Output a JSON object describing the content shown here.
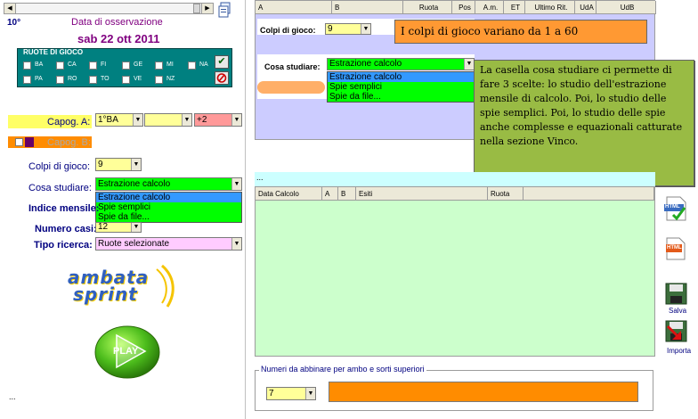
{
  "left": {
    "number": "10°",
    "obs_label": "Data di osservazione",
    "obs_date": "sab 22 ott 2011",
    "ruote": {
      "title": "RUOTE DI GIOCO",
      "row1": [
        "BA",
        "CA",
        "FI",
        "GE",
        "MI",
        "NA"
      ],
      "row2": [
        "PA",
        "RO",
        "TO",
        "VE",
        "NZ"
      ]
    },
    "capog_a": {
      "label": "Capog. A:",
      "val1": "1°BA",
      "val2": "",
      "val3": "+2"
    },
    "capog_b": {
      "label": "Capog. B:"
    },
    "colpi": {
      "label": "Colpi di gioco:",
      "value": "9"
    },
    "cosa": {
      "label": "Cosa studiare:",
      "value": "Estrazione calcolo",
      "options": [
        "Estrazione calcolo",
        "Spie semplici",
        "Spie da file..."
      ]
    },
    "indice": {
      "label": "Indice mensile:"
    },
    "numero_casi": {
      "label": "Numero casi:",
      "value": "12"
    },
    "tipo": {
      "label": "Tipo ricerca:",
      "value": "Ruote selezionate"
    },
    "logo_top": "ambata",
    "logo_bottom": "sprint",
    "play": "PLAY",
    "ellipsis": "..."
  },
  "top_grid": {
    "headers": [
      "A",
      "B",
      "Ruota",
      "Pos",
      "A.m.",
      "ET",
      "Ultimo Rit.",
      "UdA",
      "UdB"
    ]
  },
  "inner": {
    "colpi_label": "Colpi di gioco:",
    "colpi_value": "9",
    "cosa_label": "Cosa studiare:",
    "cosa_value": "Estrazione calcolo",
    "options": [
      "Estrazione calcolo",
      "Spie semplici",
      "Spie da file..."
    ]
  },
  "notes": {
    "orange": "I colpi di gioco variano da 1 a 60",
    "green": "La casella cosa studiare ci permette di fare 3 scelte: lo studio dell'estrazione mensile di calcolo. Poi, lo studio delle spie semplici. Poi, lo studio delle spie anche complesse e equazionali catturate nella sezione Vinco."
  },
  "strip": {
    "text": "..."
  },
  "bottom_grid": {
    "headers": [
      "Data Calcolo",
      "A",
      "B",
      "Esiti",
      "Ruota"
    ]
  },
  "abbinare": {
    "label": "Numeri da abbinare per ambo e sorti superiori",
    "value": "7"
  },
  "right_icons": {
    "html1": "HTML",
    "html2": "HTML",
    "salva": "Salva",
    "importa": "Importa"
  },
  "colors": {
    "green": "#00ff00",
    "yellow": "#ffff99",
    "pink": "#ff9999",
    "orange": "#ff8c00",
    "lilac": "#ffccff",
    "lightblue": "#ccffff",
    "teal": "#008080",
    "navy": "#000080"
  }
}
